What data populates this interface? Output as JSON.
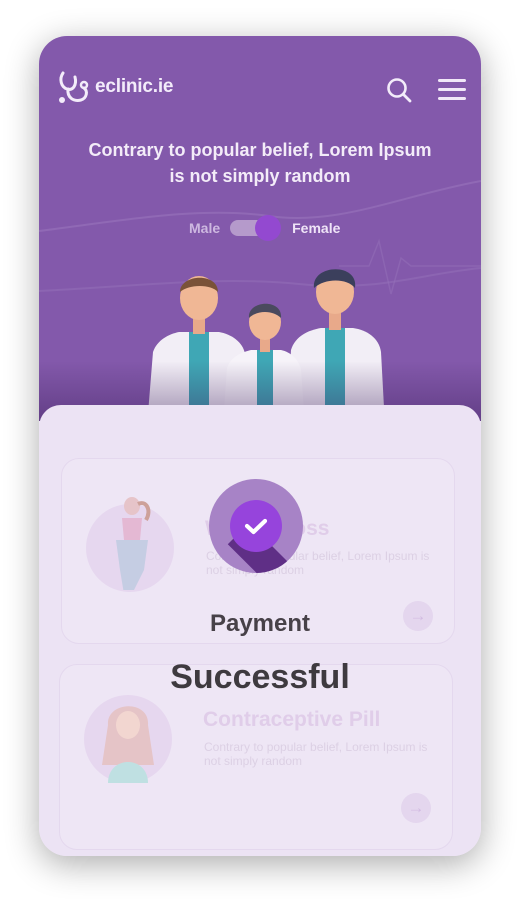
{
  "app": {
    "logo_text": "eclinic.ie",
    "logo_icon": "stethoscope-icon"
  },
  "header": {
    "headline": "Contrary to popular belief, Lorem Ipsum is not simply random",
    "search_icon": "search-icon",
    "menu_icon": "hamburger-menu-icon"
  },
  "gender_toggle": {
    "left_label": "Male",
    "right_label": "Female",
    "selected": "Female"
  },
  "services": [
    {
      "title": "Weight Loss",
      "description": "Contrary to popular belief, Lorem Ipsum is not simply random",
      "arrow": "→"
    },
    {
      "title": "Contraceptive Pill",
      "description": "Contrary to popular belief, Lorem Ipsum is not simply random",
      "arrow": "→"
    }
  ],
  "modal": {
    "icon": "check-icon",
    "line1": "Payment",
    "line2": "Successful"
  },
  "colors": {
    "brand_purple": "#8359ab",
    "accent_purple": "#9644dc",
    "card_bg": "#ece3f4"
  }
}
